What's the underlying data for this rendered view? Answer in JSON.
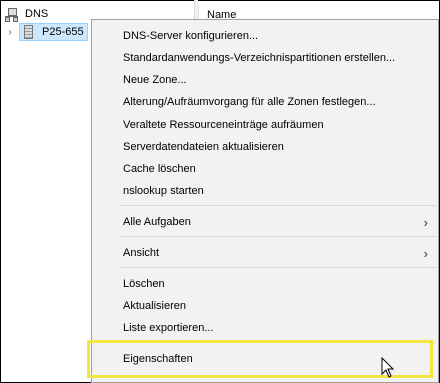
{
  "tree": {
    "root_label": "DNS",
    "server_label": "P25-655"
  },
  "list": {
    "column_name": "Name"
  },
  "context_menu": {
    "items": [
      {
        "label": "DNS-Server konfigurieren..."
      },
      {
        "label": "Standardanwendungs-Verzeichnispartitionen erstellen..."
      },
      {
        "label": "Neue Zone..."
      },
      {
        "label": "Alterung/Aufräumvorgang für alle Zonen festlegen..."
      },
      {
        "label": "Veraltete Ressourceneinträge aufräumen"
      },
      {
        "label": "Serverdatendateien aktualisieren"
      },
      {
        "label": "Cache löschen"
      },
      {
        "label": "nslookup starten"
      },
      {
        "label": "Alle Aufgaben",
        "submenu": "›"
      },
      {
        "label": "Ansicht",
        "submenu": "›"
      },
      {
        "label": "Löschen"
      },
      {
        "label": "Aktualisieren"
      },
      {
        "label": "Liste exportieren..."
      },
      {
        "label": "Eigenschaften"
      }
    ]
  },
  "highlight_color": "#f4e542",
  "selection_color": "#cce8ff"
}
